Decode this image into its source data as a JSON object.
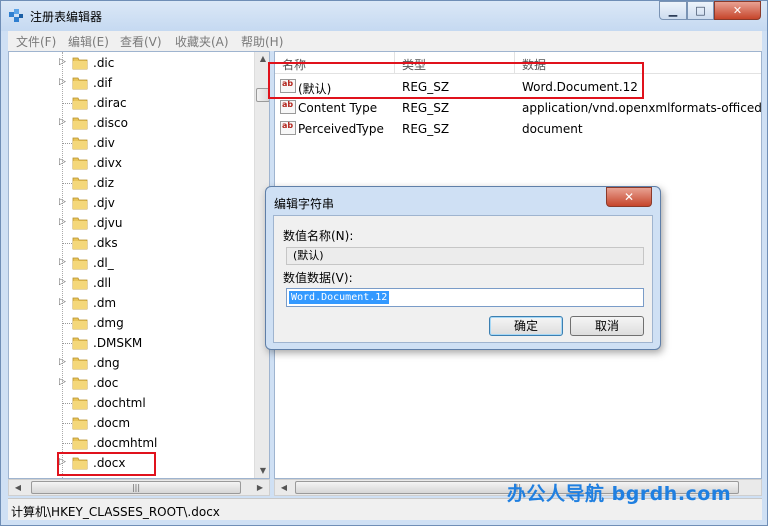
{
  "window": {
    "title": "注册表编辑器",
    "min_glyph": "0",
    "max_glyph": "□",
    "close_glyph": "✕"
  },
  "menu": [
    "文件(F)",
    "编辑(E)",
    "查看(V)",
    "收藏夹(A)",
    "帮助(H)"
  ],
  "tree": {
    "items": [
      ".dic",
      ".dif",
      ".dirac",
      ".disco",
      ".div",
      ".divx",
      ".diz",
      ".djv",
      ".djvu",
      ".dks",
      ".dl_",
      ".dll",
      ".dm",
      ".dmg",
      ".DMSKM",
      ".dng",
      ".doc",
      ".dochtml",
      ".docm",
      ".docmhtml",
      ".docx"
    ],
    "expandable": [
      true,
      true,
      false,
      true,
      false,
      true,
      false,
      true,
      true,
      false,
      true,
      true,
      true,
      false,
      false,
      true,
      true,
      false,
      false,
      false,
      true
    ],
    "selected": ".docx"
  },
  "list": {
    "columns": [
      "名称",
      "类型",
      "数据"
    ],
    "rows": [
      {
        "name": "(默认)",
        "type": "REG_SZ",
        "data": "Word.Document.12"
      },
      {
        "name": "Content Type",
        "type": "REG_SZ",
        "data": "application/vnd.openxmlformats-officedc"
      },
      {
        "name": "PerceivedType",
        "type": "REG_SZ",
        "data": "document"
      }
    ],
    "value_icon": "ab"
  },
  "status": {
    "path": "计算机\\HKEY_CLASSES_ROOT\\.docx"
  },
  "watermark": "办公人导航 bgrdh.com",
  "dialog": {
    "title": "编辑字符串",
    "close_glyph": "✕",
    "name_label": "数值名称(N):",
    "name_value": "(默认)",
    "data_label": "数值数据(V):",
    "data_value": "Word.Document.12",
    "ok": "确定",
    "cancel": "取消"
  },
  "colors": {
    "highlight_box": "#e0121c",
    "selection": "#3399ff",
    "watermark": "#1f7fe0"
  }
}
